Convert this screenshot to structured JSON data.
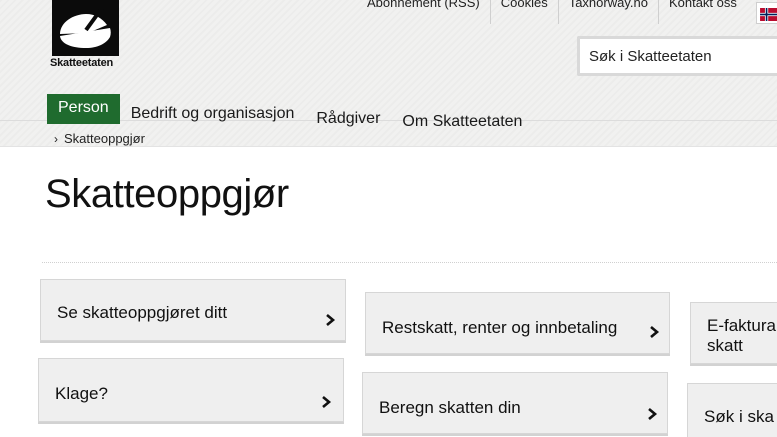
{
  "header": {
    "logo_text": "Skatteetaten",
    "top_links": [
      "Abonnement (RSS)",
      "Cookies",
      "Taxnorway.no",
      "Kontakt oss"
    ],
    "search_placeholder": "Søk i Skatteetaten",
    "flag_colors": {
      "red": "#ba0c2f",
      "blue": "#00205b",
      "white": "#ffffff"
    }
  },
  "nav": {
    "items": [
      "Person",
      "Bedrift og organisasjon",
      "Rådgiver",
      "Om Skatteetaten"
    ],
    "active": "Person",
    "active_color": "#1f6b2e"
  },
  "breadcrumb": {
    "items": [
      "Skatteoppgjør"
    ]
  },
  "page": {
    "title": "Skatteoppgjør"
  },
  "cards": [
    {
      "label": "Se skatteoppgjøret ditt"
    },
    {
      "label": "Restskatt, renter og innbetaling"
    },
    {
      "label": "E-faktura skatt"
    },
    {
      "label": "Klage?"
    },
    {
      "label": "Beregn skatten din"
    },
    {
      "label": "Søk i ska"
    }
  ]
}
